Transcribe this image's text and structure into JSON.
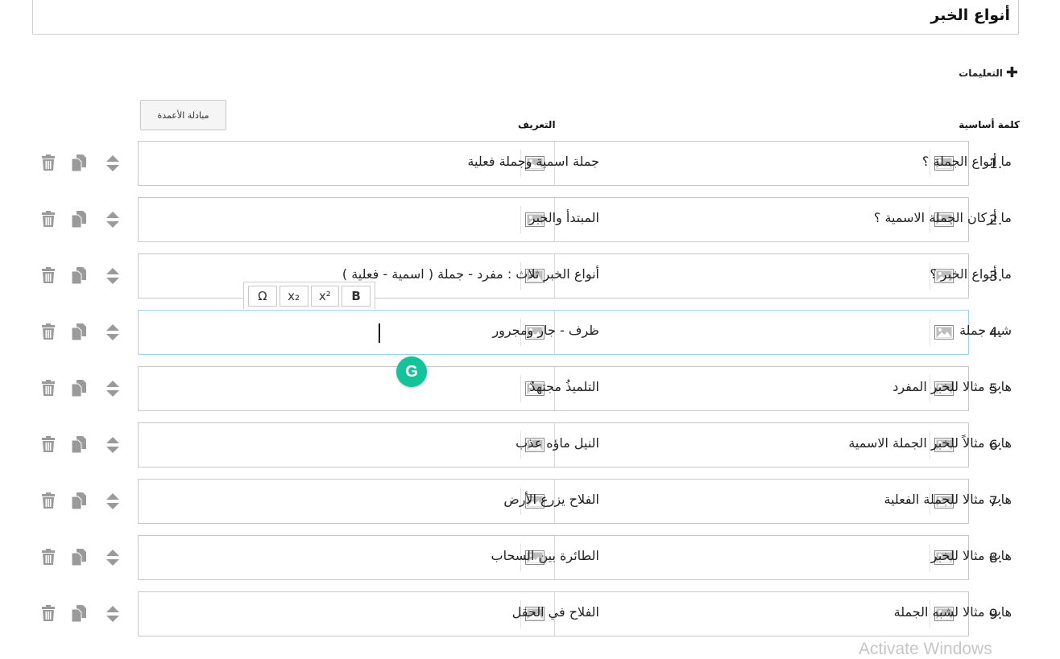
{
  "title": "أنواع الخبر",
  "instructions_label": "التعليمات",
  "swap_columns_label": "مبادلة الأعمدة",
  "headers": {
    "keyword": "كلمة أساسية",
    "definition": "التعريف"
  },
  "rows": [
    {
      "num": "1.",
      "keyword": "ما أنواع الجملة  ؟",
      "definition": "جملة اسمية وجملة فعلية"
    },
    {
      "num": "2.",
      "keyword": "ما أركان الجملة الاسمية ؟",
      "definition": "المبتدأ والخبر"
    },
    {
      "num": "3.",
      "keyword": "ما أنواع الخبر ؟",
      "definition": "أنواع الخبر ثلاث : مفرد - جملة ( اسمية - فعلية )"
    },
    {
      "num": "4.",
      "keyword": "شبه جملة",
      "definition": "ظرف - جار ومجرور"
    },
    {
      "num": "5.",
      "keyword": "هات مثالا للخبر المفرد",
      "definition": "التلميذُ مجتهدٌ"
    },
    {
      "num": "6.",
      "keyword": "هات مثالاً للخبر الجملة الاسمية",
      "definition": "النيل ماؤه عذب"
    },
    {
      "num": "7.",
      "keyword": "هات مثالا للجملة الفعلية",
      "definition": "الفلاح يزرع الأرض"
    },
    {
      "num": "8.",
      "keyword": "هات مثالا للخبر",
      "definition": "الطائرة بين السحاب"
    },
    {
      "num": "9.",
      "keyword": "هات مثالا لشبه الجملة",
      "definition": "الفلاح في الحقل"
    }
  ],
  "toolbar": {
    "omega": "Ω",
    "subscript": "x₂",
    "superscript": "x²",
    "bold": "B"
  },
  "watermark": "Activate Windows",
  "colors": {
    "grammarly": "#15c39a",
    "active_border": "#9fd4e8",
    "border": "#c9c9c9"
  }
}
